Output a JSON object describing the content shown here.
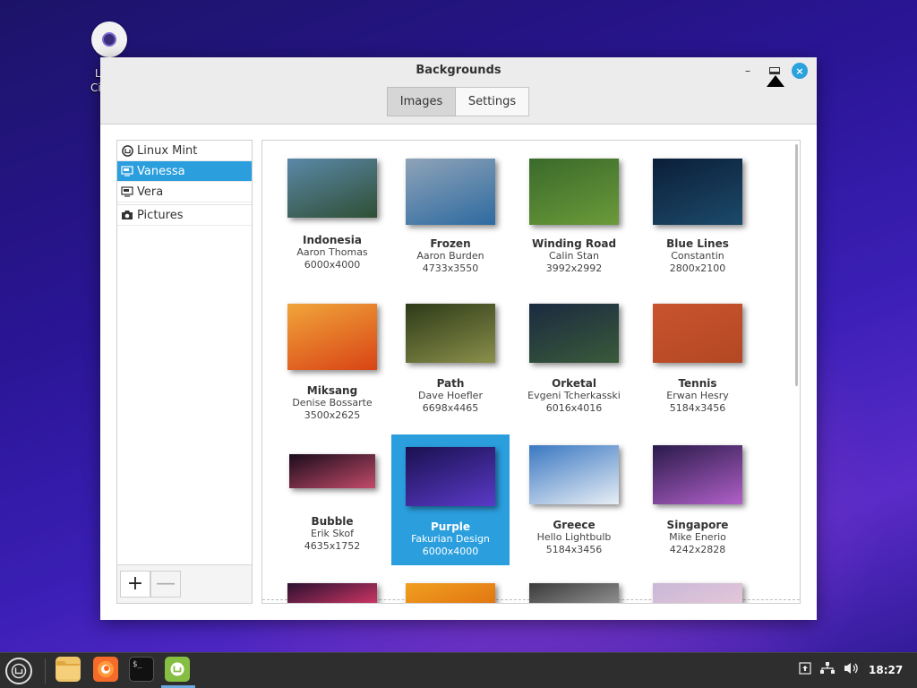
{
  "desktop": {
    "icon_label_line1": "Linux",
    "icon_label_line2": "Cinnan"
  },
  "window": {
    "title": "Backgrounds",
    "minimize": "–",
    "close": "×",
    "tabs": [
      {
        "label": "Images",
        "active": true
      },
      {
        "label": "Settings",
        "active": false
      }
    ]
  },
  "sidebar": {
    "items": [
      {
        "label": "Linux Mint",
        "icon": "mint-icon",
        "selected": false
      },
      {
        "label": "Vanessa",
        "icon": "monitor-icon",
        "selected": true
      },
      {
        "label": "Vera",
        "icon": "monitor-icon",
        "selected": false
      },
      {
        "label": "Pictures",
        "icon": "camera-icon",
        "selected": false
      }
    ],
    "add_label": "+",
    "remove_label": "—"
  },
  "gallery": {
    "items": [
      {
        "name": "Indonesia",
        "author": "Aaron Thomas",
        "size": "6000x4000",
        "colors": [
          "#5b88a8",
          "#2f4f35"
        ]
      },
      {
        "name": "Frozen",
        "author": "Aaron Burden",
        "size": "4733x3550",
        "colors": [
          "#8fa3b8",
          "#2d6aa0"
        ]
      },
      {
        "name": "Winding Road",
        "author": "Calin Stan",
        "size": "3992x2992",
        "colors": [
          "#3a6a2a",
          "#6b9a3a"
        ]
      },
      {
        "name": "Blue Lines",
        "author": "Constantin",
        "size": "2800x2100",
        "colors": [
          "#0b1e38",
          "#1c4a6a"
        ]
      },
      {
        "name": "Miksang",
        "author": "Denise Bossarte",
        "size": "3500x2625",
        "colors": [
          "#f0a53a",
          "#d94315"
        ]
      },
      {
        "name": "Path",
        "author": "Dave Hoefler",
        "size": "6698x4465",
        "colors": [
          "#2d3a18",
          "#8a8f4a"
        ]
      },
      {
        "name": "Orketal",
        "author": "Evgeni Tcherkasski",
        "size": "6016x4016",
        "colors": [
          "#1a2a40",
          "#3a5a3a"
        ]
      },
      {
        "name": "Tennis",
        "author": "Erwan Hesry",
        "size": "5184x3456",
        "colors": [
          "#c8532e",
          "#b44824"
        ]
      },
      {
        "name": "Bubble",
        "author": "Erik Skof",
        "size": "4635x1752",
        "colors": [
          "#1a0c1a",
          "#c24a6a"
        ]
      },
      {
        "name": "Purple",
        "author": "Fakurian Design",
        "size": "6000x4000",
        "colors": [
          "#1a1150",
          "#5a3ac8"
        ],
        "selected": true
      },
      {
        "name": "Greece",
        "author": "Hello Lightbulb",
        "size": "5184x3456",
        "colors": [
          "#3a78c2",
          "#e8eef5"
        ]
      },
      {
        "name": "Singapore",
        "author": "Mike Enerio",
        "size": "4242x2828",
        "colors": [
          "#2a1a4a",
          "#b060c8"
        ]
      },
      {
        "colors": [
          "#2a1030",
          "#e03a6a"
        ]
      },
      {
        "colors": [
          "#f0a020",
          "#e07010"
        ]
      },
      {
        "colors": [
          "#3a3a3a",
          "#9a9a9a"
        ]
      },
      {
        "colors": [
          "#c8b8d8",
          "#e8c8d8"
        ]
      }
    ]
  },
  "taskbar": {
    "clock": "18:27",
    "terminal_text": "$_"
  }
}
